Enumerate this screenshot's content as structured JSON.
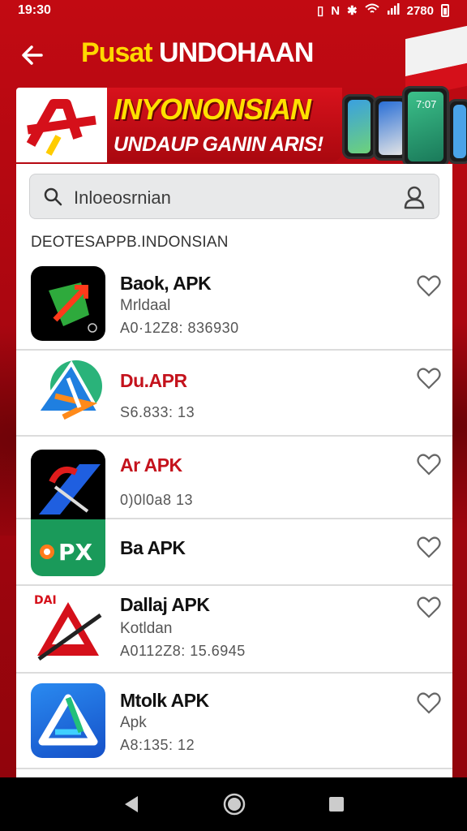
{
  "status_bar": {
    "time": "19:30",
    "right_text": "2780"
  },
  "header": {
    "title_part1": "Pusat",
    "title_part2": "UNDOHAAN"
  },
  "banner": {
    "title": "INYONONSIAN",
    "subtitle": "UNDAUP GANIN ARIS!",
    "phone_time": "7:07"
  },
  "search": {
    "placeholder": "Inloeosrnian"
  },
  "section_label": "DEOTESAPPB.INDONSIAN",
  "apps": [
    {
      "name": "Baok, APK",
      "sub": "Mrldaal",
      "meta": "A0·12Z8: 836930",
      "name_color": "black"
    },
    {
      "name": "Du.APR",
      "sub": "",
      "meta": "S6.833: 13",
      "name_color": "red"
    },
    {
      "name": "Ar APK",
      "sub": "",
      "meta": "0)0l0a8 13",
      "name_color": "red"
    },
    {
      "name": "Ba APK",
      "sub": "",
      "meta": "",
      "name_color": "black",
      "icon_text": "PX"
    },
    {
      "name": "Dallaj APK",
      "sub": "Kotldan",
      "meta": "A0112Z8: 15.6945",
      "name_color": "black",
      "icon_text": "DAI"
    },
    {
      "name": "Mtolk APK",
      "sub": "Apk",
      "meta": "A8:135: 12",
      "name_color": "black"
    }
  ],
  "colors": {
    "brand_red": "#c20a12",
    "accent_yellow": "#ffd800"
  }
}
